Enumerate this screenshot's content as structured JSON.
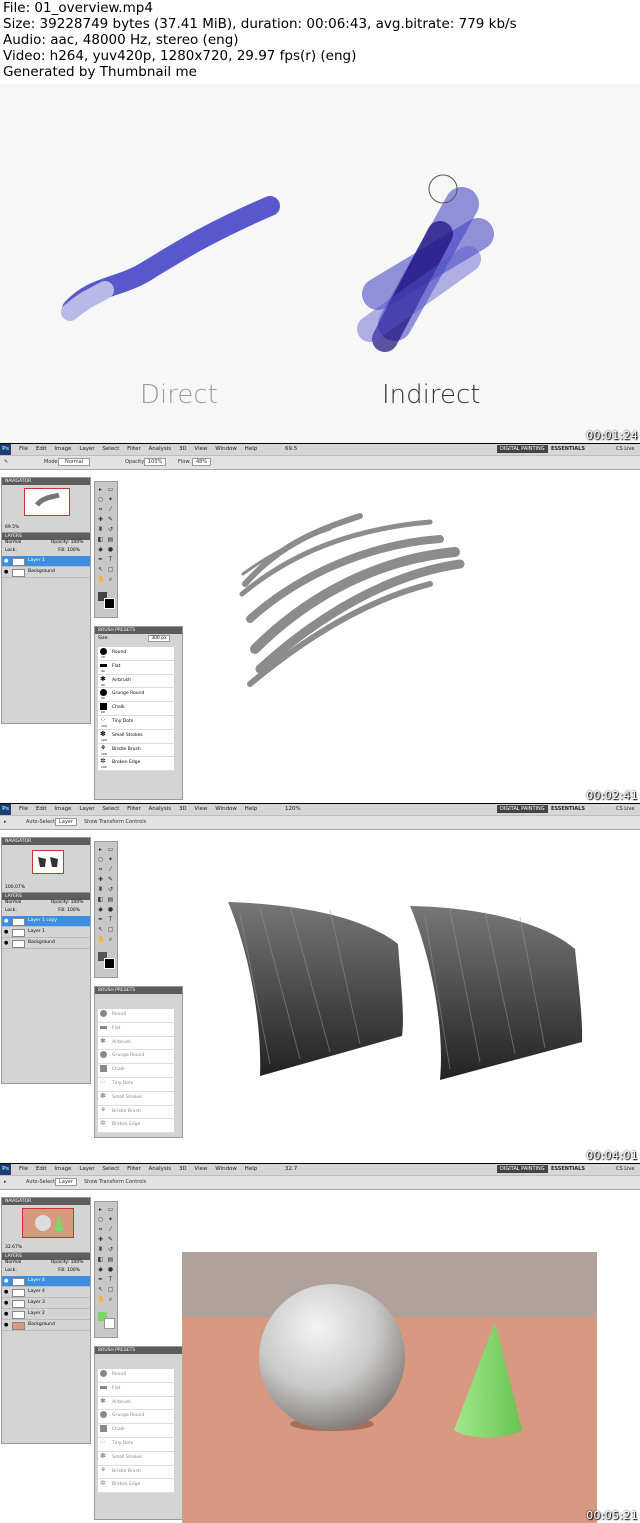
{
  "info": {
    "line1": "File: 01_overview.mp4",
    "line2": "Size: 39228749 bytes (37.41 MiB), duration: 00:06:43, avg.bitrate: 779 kb/s",
    "line3": "Audio: aac, 48000 Hz, stereo (eng)",
    "line4": "Video: h264, yuv420p, 1280x720, 29.97 fps(r) (eng)",
    "line5": "Generated by Thumbnail me"
  },
  "frames": [
    {
      "timestamp": "00:01:24",
      "label_left": "Direct",
      "label_right": "Indirect"
    },
    {
      "timestamp": "00:02:41"
    },
    {
      "timestamp": "00:04:01"
    },
    {
      "timestamp": "00:05:21"
    }
  ],
  "photoshop": {
    "logo": "Ps",
    "menu": [
      "File",
      "Edit",
      "Image",
      "Layer",
      "Select",
      "Filter",
      "Analysis",
      "3D",
      "View",
      "Window",
      "Help"
    ],
    "workspace_painting": "DIGITAL PAINTING",
    "workspace_essentials": "ESSENTIALS",
    "cslive": "CS Live",
    "navigator_title": "NAVIGATOR",
    "layers_title": "LAYERS",
    "brush_presets_title": "BRUSH PRESETS",
    "blend_mode": "Normal",
    "opacity_label": "Opacity:",
    "opacity_value": "100%",
    "fill_label": "Fill:",
    "fill_value": "100%",
    "lock_label": "Lock:",
    "size_label": "Size:",
    "size_value": "300 px",
    "mode_label": "Mode:",
    "flow_label": "Flow:",
    "flow_value": "48%",
    "auto_select": "Auto-Select:",
    "auto_select_value": "Layer",
    "show_transform": "Show Transform Controls",
    "frame2": {
      "zoom": "69.5%",
      "layers": [
        "Layer 1",
        "Background"
      ],
      "zoom_menu": "69.5"
    },
    "frame3": {
      "zoom": "100.07%",
      "layers": [
        "Layer 1 copy",
        "Layer 1",
        "Background"
      ],
      "zoom_menu": "120%"
    },
    "frame4": {
      "zoom": "32.67%",
      "layers": [
        "Layer 4",
        "Layer 4",
        "Layer 3",
        "Layer 2",
        "Background"
      ],
      "zoom_menu": "32.7"
    },
    "brushes": [
      {
        "name": "Round",
        "size": "70"
      },
      {
        "name": "Flat",
        "size": "90"
      },
      {
        "name": "Airbrush",
        "size": "90"
      },
      {
        "name": "Grunge Round",
        "size": "90"
      },
      {
        "name": "Chalk",
        "size": "60"
      },
      {
        "name": "Tiny Dots",
        "size": "100"
      },
      {
        "name": "Small Strokes",
        "size": "120"
      },
      {
        "name": "Bristle Brush",
        "size": "100"
      },
      {
        "name": "Broken Edge",
        "size": "100"
      }
    ]
  },
  "colors": {
    "stroke_blue": "#4646c8",
    "stroke_dark": "#1a0d7a",
    "cone_green": "#7fd56a",
    "table_salmon": "#d79a80",
    "selected_layer": "#3d8ee0"
  }
}
